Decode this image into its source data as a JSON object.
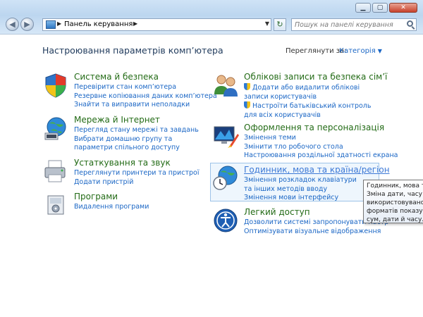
{
  "window": {
    "minimize_label": "▁",
    "maximize_label": "▢",
    "close_label": "✕"
  },
  "navbar": {
    "back_glyph": "◀",
    "forward_glyph": "▶",
    "address_chevron": "▶",
    "breadcrumb": "Панель керування",
    "breadcrumb_chevron": "▶",
    "refresh_glyph": "↻",
    "search_placeholder": "Пошук на панелі керування"
  },
  "page": {
    "heading": "Настроювання параметрів комп’ютера",
    "view_by_label": "Переглянути за:",
    "view_by_value": "Категорія"
  },
  "categories": {
    "system": {
      "title": "Система й безпека",
      "links": [
        "Перевірити стан комп’ютера",
        "Резервне копіювання даних комп’ютера",
        "Знайти та виправити неполадки"
      ]
    },
    "network": {
      "title": "Мережа й Інтернет",
      "links": [
        "Перегляд стану мережі та завдань",
        "Вибрати домашню групу та параметри спільного доступу"
      ]
    },
    "hardware": {
      "title": "Устаткування та звук",
      "links": [
        "Переглянути принтери та пристрої",
        "Додати пристрій"
      ]
    },
    "programs": {
      "title": "Програми",
      "links": [
        "Видалення програми"
      ]
    },
    "accounts": {
      "title": "Облікові записи та безпека сім’ї",
      "links": [
        "Додати або видалити облікові записи користувачів",
        "Настроїти батьківський контроль для всіх користувачів"
      ]
    },
    "appearance": {
      "title": "Оформлення та персоналізація",
      "links": [
        "Змінення теми",
        "Змінити тло робочого стола",
        "Настроювання роздільної здатності екрана"
      ]
    },
    "clock": {
      "title": "Годинник, мова та країна/регіон",
      "links": [
        "Змінення розкладок клавіатури та інших методів вводу",
        "Змінення мови інтерфейсу"
      ]
    },
    "ease": {
      "title": "Легкий доступ",
      "links": [
        "Дозволити системі запропонувати настр",
        "Оптимізувати візуальне відображення"
      ]
    }
  },
  "tooltip": {
    "lines": [
      "Годинник, мова та к",
      "Зміна дати, часу й ч",
      "використовуваної м",
      "форматів показу чи",
      "сум, дати й часу."
    ]
  }
}
